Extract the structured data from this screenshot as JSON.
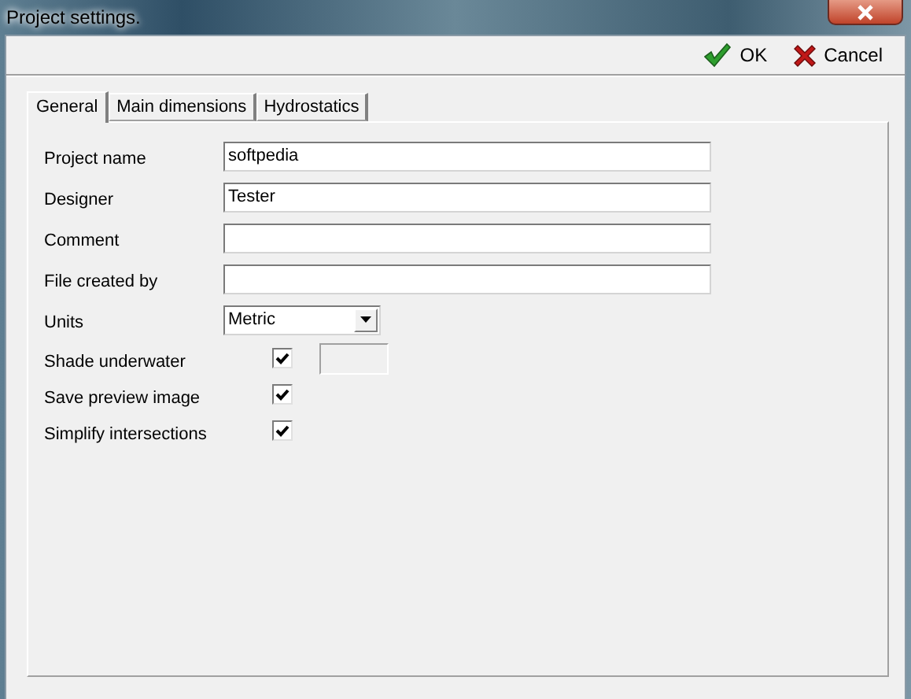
{
  "window": {
    "title": "Project settings."
  },
  "toolbar": {
    "buttons": [
      {
        "kind": "ok",
        "label": "OK"
      },
      {
        "kind": "cancel",
        "label": "Cancel"
      }
    ]
  },
  "tabs": [
    {
      "label": "General",
      "selected": true
    },
    {
      "label": "Main dimensions",
      "selected": false
    },
    {
      "label": "Hydrostatics",
      "selected": false
    }
  ],
  "fields": [
    {
      "kind": "text",
      "label": "Project name",
      "value": "softpedia"
    },
    {
      "kind": "text",
      "label": "Designer",
      "value": "Tester"
    },
    {
      "kind": "text",
      "label": "Comment"
    },
    {
      "kind": "text",
      "label": "File created by"
    },
    {
      "kind": "select",
      "label": "Units",
      "value": "Metric"
    },
    {
      "kind": "checkbox",
      "label": "Shade underwater",
      "checked": true,
      "swatch": true
    },
    {
      "kind": "checkbox",
      "label": "Save preview image",
      "checked": true
    },
    {
      "kind": "checkbox",
      "label": "Simplify intersections",
      "checked": true
    }
  ]
}
